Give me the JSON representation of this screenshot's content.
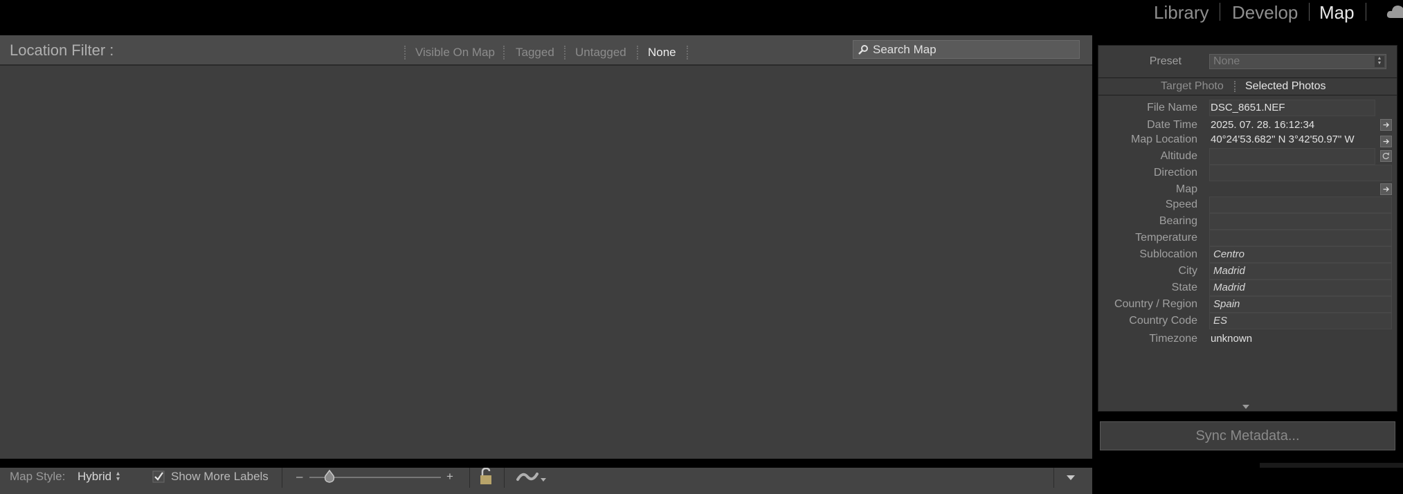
{
  "modules": {
    "library": "Library",
    "develop": "Develop",
    "map": "Map",
    "active": "Map"
  },
  "filter_bar": {
    "title": "Location Filter :",
    "options": [
      "Visible On Map",
      "Tagged",
      "Untagged",
      "None"
    ],
    "active_option": "None",
    "search_placeholder": "Search Map"
  },
  "bottom_bar": {
    "map_style_label": "Map Style:",
    "map_style_value": "Hybrid",
    "show_more_labels": "Show More Labels",
    "show_more_labels_checked": true,
    "zoom_minus": "–",
    "zoom_plus": "+",
    "zoom_level": 0.15
  },
  "metadata": {
    "preset_label": "Preset",
    "preset_value": "None",
    "tabs": [
      "Target Photo",
      "Selected Photos"
    ],
    "active_tab": "Selected Photos",
    "fields": [
      {
        "label": "File Name",
        "value": "DSC_8651.NEF"
      },
      {
        "label": "Date Time",
        "value": "2025. 07. 28. 16:12:34"
      },
      {
        "label": "Map Location",
        "value": "40°24'53.682\" N 3°42'50.97\" W"
      },
      {
        "label": "Altitude",
        "value": ""
      },
      {
        "label": "Direction",
        "value": ""
      },
      {
        "label": "Map",
        "value": ""
      },
      {
        "label": "Speed",
        "value": ""
      },
      {
        "label": "Bearing",
        "value": ""
      },
      {
        "label": "Temperature",
        "value": ""
      },
      {
        "label": "Sublocation",
        "value": "Centro"
      },
      {
        "label": "City",
        "value": "Madrid"
      },
      {
        "label": "State",
        "value": "Madrid"
      },
      {
        "label": "Country / Region",
        "value": "Spain"
      },
      {
        "label": "Country Code",
        "value": "ES"
      },
      {
        "label": "Timezone",
        "value": "unknown"
      }
    ],
    "sync_button": "Sync Metadata..."
  },
  "colors": {
    "panel_bg": "#3e3e3e",
    "toolbar_bg": "#4b4b4b",
    "active_text": "#e8e8e8",
    "inactive_text": "#8e8e8e"
  },
  "icons": [
    "search-icon",
    "checkbox-check-icon",
    "zoom-slider-thumb-icon",
    "lock-icon",
    "tracklog-icon",
    "chevron-down-icon",
    "cloud-icon",
    "arrow-right-icon",
    "refresh-icon"
  ]
}
